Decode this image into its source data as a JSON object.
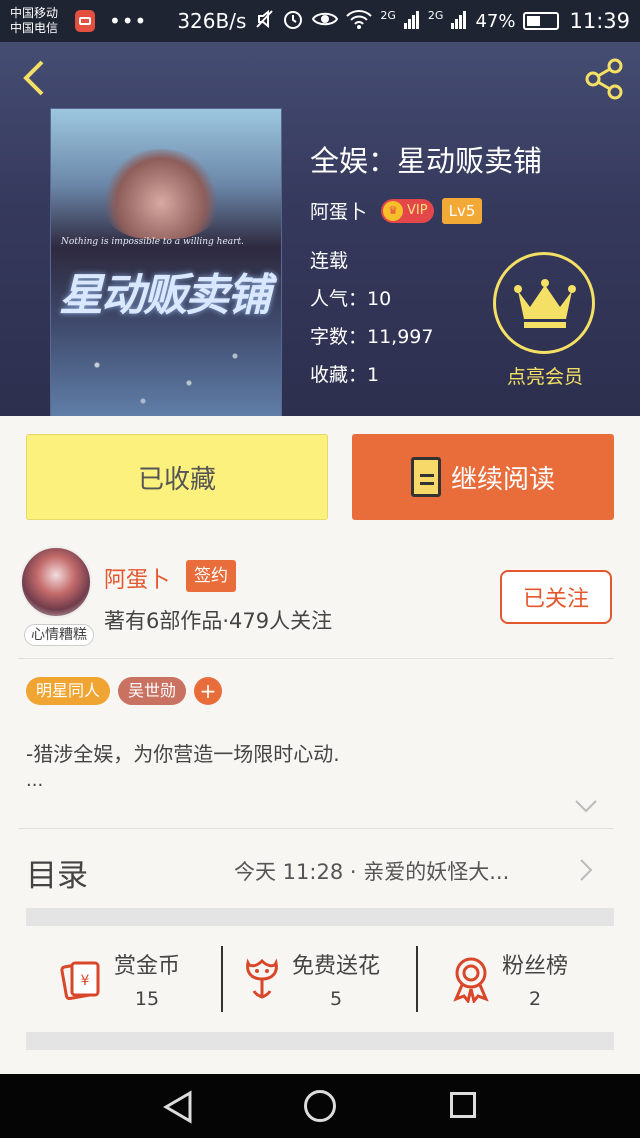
{
  "status_bar": {
    "carrier1": "中国移动",
    "carrier2": "中国电信",
    "dots": "•••",
    "speed": "326B/s",
    "signal1": "2G",
    "signal2": "2G",
    "battery": "47%",
    "battery_level": 0.47,
    "time": "11:39"
  },
  "book": {
    "title": "全娱：星动贩卖铺",
    "author": "阿蛋卜",
    "vip_text": "VIP",
    "level": "Lv5",
    "status": "连载",
    "popularity": "人气：10",
    "word_count": "字数：11,997",
    "favorites": "收藏：1",
    "cover": {
      "subtitle": "Nothing is impossible to a willing heart.",
      "title": "星动贩卖铺"
    }
  },
  "vip_promo": {
    "label": "点亮会员"
  },
  "actions": {
    "collected_label": "已收藏",
    "read_label": "继续阅读"
  },
  "author_section": {
    "name": "阿蛋卜",
    "sign_badge": "签约",
    "avatar_tag": "心情糟糕",
    "stats": "著有6部作品·479人关注",
    "follow_label": "已关注"
  },
  "tags": [
    "明星同人",
    "吴世勋"
  ],
  "tag_add": "+",
  "description": {
    "text": "-猎涉全娱，为你营造一场限时心动.",
    "more": "..."
  },
  "toc": {
    "label": "目录",
    "latest": "今天 11:28 · 亲爱的妖怪大..."
  },
  "stats_row": [
    {
      "label": "赏金币",
      "value": "15",
      "icon": "red-envelope-icon"
    },
    {
      "label": "免费送花",
      "value": "5",
      "icon": "flower-icon"
    },
    {
      "label": "粉丝榜",
      "value": "2",
      "icon": "medal-icon"
    }
  ],
  "colors": {
    "accent": "#e96c3b",
    "collected_bg": "#fbf17c",
    "vip_gold": "#f5e066",
    "header_bg": "#3a3f63"
  }
}
